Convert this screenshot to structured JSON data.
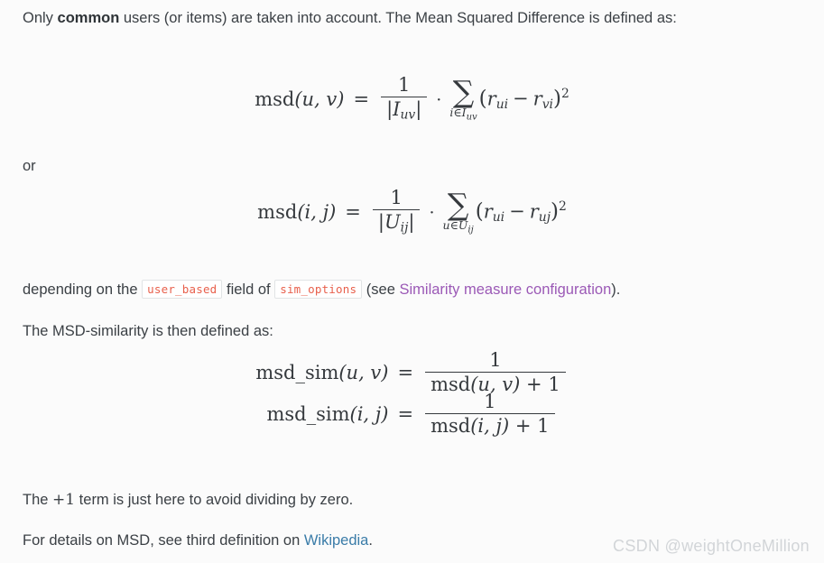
{
  "page": {
    "background_color": "#fbfbfb",
    "text_color": "#3b4045",
    "code_color": "#e8604c",
    "visited_link_color": "#9b59b6",
    "link_color": "#3a7ca8"
  },
  "intro": {
    "before_bold": "Only ",
    "bold": "common",
    "after_bold": " users (or items) are taken into account. The Mean Squared Difference is defined as:"
  },
  "or_text": "or",
  "depending": {
    "lead": "depending on the",
    "code_1": "user_based",
    "middle": "field of",
    "code_2": "sim_options",
    "see_open": "(see",
    "link_label": "Similarity measure configuration",
    "close": ")."
  },
  "msd_sim_lead": "The MSD-similarity is then defined as:",
  "plus_one_note": {
    "prefix": "The ",
    "math": "+1",
    "suffix": " term is just here to avoid dividing by zero."
  },
  "wiki_note": {
    "prefix": "For details on MSD, see third definition on ",
    "link_label": "Wikipedia",
    "suffix": "."
  },
  "equations": {
    "eq1": {
      "lhs_fn": "msd",
      "lhs_args": "(u, v)",
      "rel": "=",
      "frac_num": "1",
      "frac_den_open": "|",
      "frac_den_var": "I",
      "frac_den_sub": "uv",
      "frac_den_close": "|",
      "dot": "·",
      "sum_symbol": "∑",
      "sum_sub_index": "i",
      "sum_sub_in": "∈",
      "sum_sub_set": "I",
      "sum_sub_set_sub": "uv",
      "term_open": "(",
      "term_r1": "r",
      "term_r1_sub": "ui",
      "term_minus": "−",
      "term_r2": "r",
      "term_r2_sub": "vi",
      "term_close": ")",
      "term_power": "2"
    },
    "eq2": {
      "lhs_fn": "msd",
      "lhs_args": "(i, j)",
      "rel": "=",
      "frac_num": "1",
      "frac_den_open": "|",
      "frac_den_var": "U",
      "frac_den_sub": "ij",
      "frac_den_close": "|",
      "dot": "·",
      "sum_symbol": "∑",
      "sum_sub_index": "u",
      "sum_sub_in": "∈",
      "sum_sub_set": "U",
      "sum_sub_set_sub": "ij",
      "term_open": "(",
      "term_r1": "r",
      "term_r1_sub": "ui",
      "term_minus": "−",
      "term_r2": "r",
      "term_r2_sub": "uj",
      "term_close": ")",
      "term_power": "2"
    },
    "eq3a": {
      "lhs_fn": "msd_sim",
      "lhs_args": "(u, v)",
      "rel": "=",
      "frac_num": "1",
      "den_fn": "msd",
      "den_args": "(u, v)",
      "den_plus": "+ 1"
    },
    "eq3b": {
      "lhs_fn": "msd_sim",
      "lhs_args": "(i, j)",
      "rel": "=",
      "frac_num": "1",
      "den_fn": "msd",
      "den_args": "(i, j)",
      "den_plus": "+ 1"
    }
  },
  "watermark": "CSDN @weightOneMillion"
}
